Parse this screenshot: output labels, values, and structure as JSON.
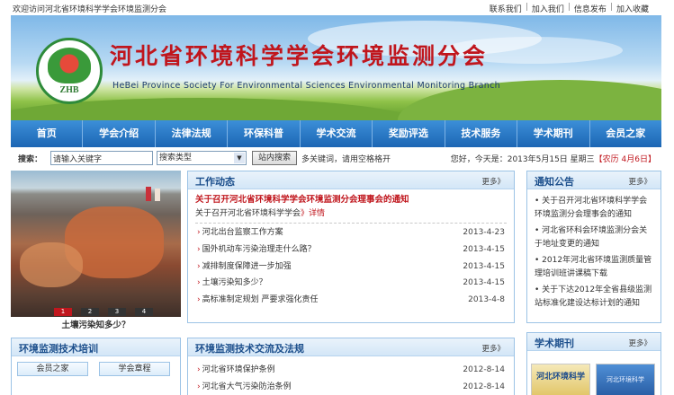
{
  "topbar": {
    "welcome": "欢迎访问河北省环境科学学会环境监测分会",
    "links": [
      "联系我们",
      "加入我们",
      "信息发布",
      "加入收藏"
    ]
  },
  "banner": {
    "logo_text": "ZHB",
    "title": "河北省环境科学学会环境监测分会",
    "subtitle": "HeBei Province Society For Environmental Sciences Environmental Monitoring Branch"
  },
  "nav": {
    "items": [
      "首页",
      "学会介绍",
      "法律法规",
      "环保科普",
      "学术交流",
      "奖励评选",
      "技术服务",
      "学术期刊",
      "会员之家"
    ]
  },
  "search": {
    "label": "搜索：",
    "input_value": "请输入关键字",
    "select_value": "搜索类型",
    "button": "站内搜索",
    "hint": "多关键词，请用空格格开",
    "date_prefix": "您好，今天是：2013年5月15日 星期三",
    "lunar": "【农历 4月6日】"
  },
  "slideshow": {
    "dots": [
      "1",
      "2",
      "3",
      "4"
    ],
    "caption": "土壤污染知多少？"
  },
  "work": {
    "title": "工作动态",
    "more": "更多》",
    "headline": "关于召开河北省环境科学学会环境监测分会理事会的通知",
    "headline_sub": "关于召开河北省环境科学学会",
    "detail": "》详情",
    "items": [
      {
        "text": "河北出台监察工作方案",
        "date": "2013-4-23"
      },
      {
        "text": "国外机动车污染治理走什么路？",
        "date": "2013-4-15"
      },
      {
        "text": "减排制度保障进一步加强",
        "date": "2013-4-15"
      },
      {
        "text": "土壤污染知多少？",
        "date": "2013-4-15"
      },
      {
        "text": "高标准制定规划 严要求强化责任",
        "date": "2013-4-8"
      }
    ]
  },
  "notice": {
    "title": "通知公告",
    "more": "更多》",
    "items": [
      "关于召开河北省环境科学学会环境监测分会理事会的通知",
      "河北省环科会环境监测分会关于地址变更的通知",
      "2012年河北省环境监测质量管理培训班讲课稿下载",
      "关于下达2012年全省县级监测站标准化建设达标计划的通知"
    ]
  },
  "training": {
    "title": "环境监测技术培训",
    "buttons": [
      "会员之家",
      "学会章程"
    ]
  },
  "exchange": {
    "title": "环境监测技术交流及法规",
    "more": "更多》",
    "items": [
      {
        "text": "河北省环境保护条例",
        "date": "2012-8-14"
      },
      {
        "text": "河北省大气污染防治条例",
        "date": "2012-8-14"
      }
    ]
  },
  "journal": {
    "title": "学术期刊",
    "more": "更多》",
    "cover1": "河北环境科学",
    "cover2": "河北环境科学"
  }
}
